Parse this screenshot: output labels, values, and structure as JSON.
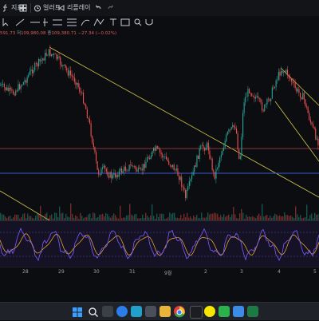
{
  "toolbar": {
    "indicators_label": "지표",
    "alerts_label": "얼러트",
    "replay_label": "리플레이"
  },
  "ohlc": {
    "partial_value": "591.73",
    "low_key": "저",
    "low_value": "109,980.08",
    "close_key": "종",
    "close_value": "109,380.71",
    "change": "−27.34 (−0.02%)"
  },
  "x_axis": {
    "labels": [
      "28",
      "29",
      "30",
      "31",
      "9월",
      "2",
      "3",
      "4",
      "5"
    ]
  },
  "colors": {
    "background": "#0c0d10",
    "candle_up": "#26a69a",
    "candle_down": "#ef5350",
    "trendline": "#d4c84a",
    "level_red": "#b0404a",
    "level_blue": "#3b5bd6",
    "osc_fast": "#7b5cff",
    "osc_slow": "#e0a030"
  },
  "taskbar": {
    "icons": [
      "windows-start-icon",
      "search-icon",
      "file-explorer-icon",
      "store-icon",
      "edge-icon",
      "settings-icon",
      "folder-icon",
      "chrome-icon",
      "tradingview-icon",
      "kakaotalk-icon",
      "app-icon",
      "app-icon",
      "excel-icon",
      "spotify-icon"
    ]
  }
}
